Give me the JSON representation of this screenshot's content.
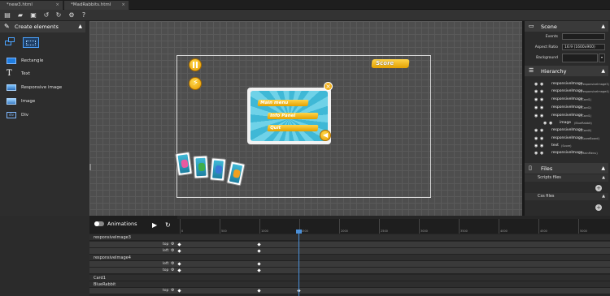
{
  "tabs": [
    {
      "label": "*new3.html"
    },
    {
      "label": "*MadRabbits.html"
    }
  ],
  "toolbar_icons": [
    "new-file-icon",
    "open-folder-icon",
    "save-icon",
    "undo-icon",
    "redo-icon",
    "settings-icon",
    "help-icon"
  ],
  "left_panel": {
    "title": "Create elements",
    "elements": [
      {
        "label": "Rectangle",
        "icon": "rectangle-icon"
      },
      {
        "label": "Text",
        "icon": "text-icon"
      },
      {
        "label": "Responsive image",
        "icon": "responsive-image-icon"
      },
      {
        "label": "Image",
        "icon": "image-icon"
      },
      {
        "label": "Div",
        "icon": "div-icon"
      }
    ]
  },
  "canvas": {
    "score_label": "Score",
    "menu_buttons": [
      "Main menu",
      "Info Panel",
      "Quit"
    ]
  },
  "scene": {
    "title": "Scene",
    "events_label": "Events",
    "aspect_ratio_label": "Aspect Ratio",
    "aspect_ratio_value": "16:9 (1600x900)",
    "background_label": "Background"
  },
  "hierarchy": {
    "title": "Hierarchy",
    "items": [
      {
        "name": "responsiveImage",
        "tag": "(responsiveImage3)",
        "indent": 0
      },
      {
        "name": "responsiveImage",
        "tag": "(responsiveImage4)",
        "indent": 0
      },
      {
        "name": "responsiveImage",
        "tag": "(Card1)",
        "indent": 0
      },
      {
        "name": "responsiveImage",
        "tag": "(Card2)",
        "indent": 0
      },
      {
        "name": "responsiveImage",
        "tag": "(Card1)",
        "indent": 0
      },
      {
        "name": "image",
        "tag": "(BlueRabbit)",
        "indent": 1
      },
      {
        "name": "responsiveImage",
        "tag": "(Card4)",
        "indent": 0
      },
      {
        "name": "responsiveImage",
        "tag": "(ScoreBoard)",
        "indent": 0
      },
      {
        "name": "text",
        "tag": "(Score)",
        "indent": 0
      },
      {
        "name": "responsiveImage",
        "tag": "(MainMenu)",
        "indent": 0
      }
    ]
  },
  "files": {
    "title": "Files",
    "scripts_label": "Scripts files",
    "css_label": "Css files"
  },
  "animations": {
    "title": "Animations",
    "ruler_labels": [
      "0",
      "500",
      "1000",
      "1500",
      "2000",
      "2500",
      "3000",
      "3500",
      "4000",
      "4500",
      "5000",
      "5500",
      "6000"
    ],
    "tracks": [
      {
        "label": "responsiveImage3",
        "type": "group"
      },
      {
        "label": "top",
        "type": "prop"
      },
      {
        "label": "left",
        "type": "prop"
      },
      {
        "label": "responsiveImage4",
        "type": "group"
      },
      {
        "label": "left",
        "type": "prop"
      },
      {
        "label": "top",
        "type": "prop"
      },
      {
        "label": "Card1",
        "type": "group"
      },
      {
        "label": "BlueRabbit",
        "type": "group"
      },
      {
        "label": "top",
        "type": "prop"
      }
    ]
  }
}
